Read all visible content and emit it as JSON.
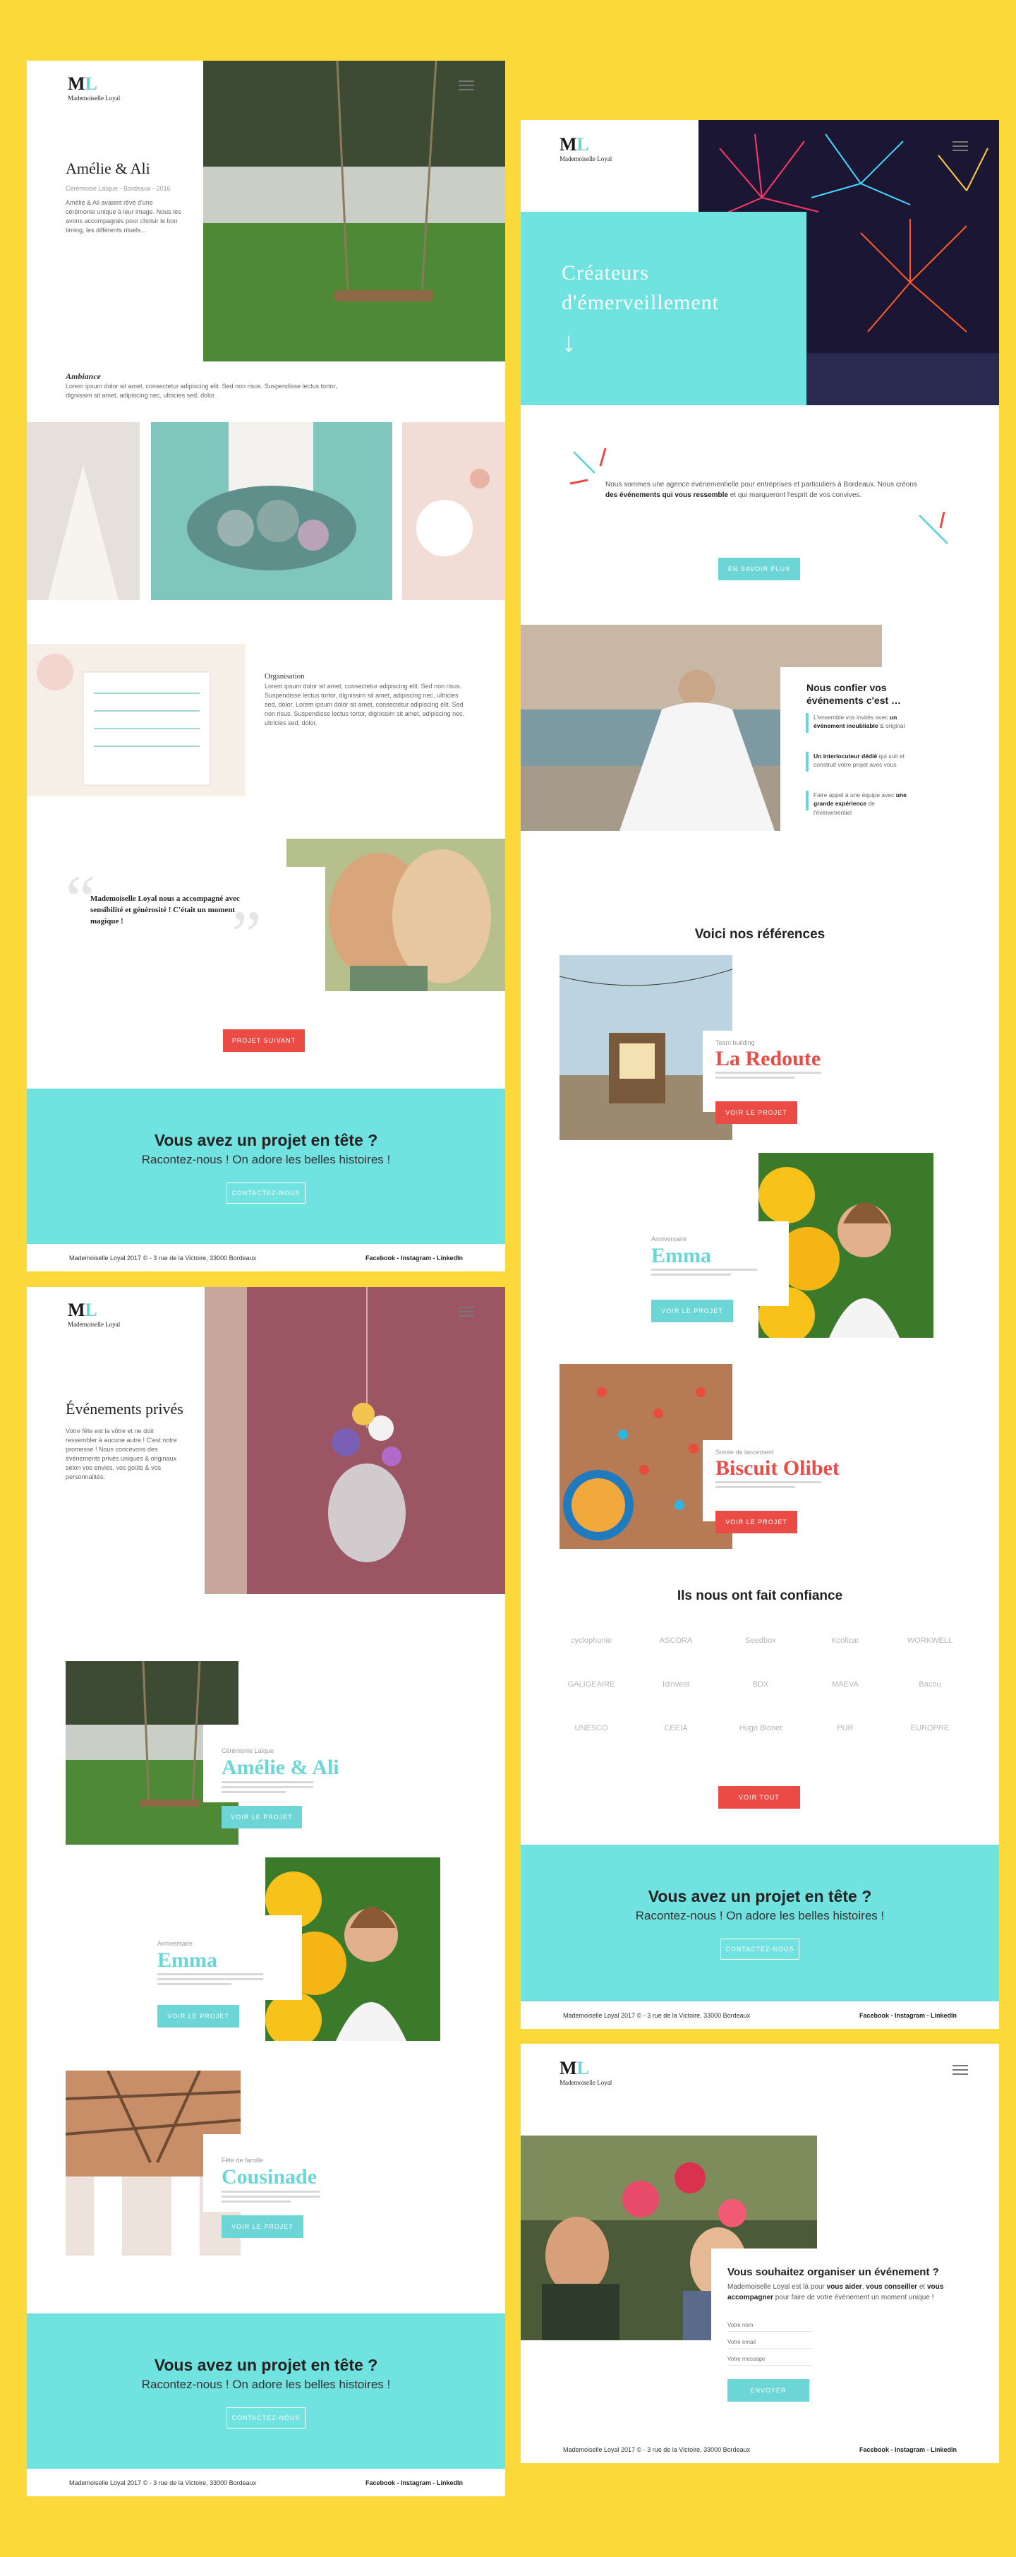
{
  "brand": {
    "mark_a": "M",
    "mark_b": "L",
    "name": "Mademoiselle Loyal"
  },
  "project_page": {
    "title": "Amélie & Ali",
    "meta": "Cérémonie Laïque - Bordeaux - 2016",
    "intro": "Amélie & Ali avaient rêvé d'une cérémonie unique à leur image. Nous les avons accompagnés pour choisir le bon timing, les différents rituels…",
    "ambiance_label": "Ambiance",
    "ambiance_text": "Lorem ipsum dolor sit amet, consectetur adipiscing elit. Sed non risus. Suspendisse lectus tortor, dignissim sit amet, adipiscing nec, ultricies sed, dolor.",
    "organisation_label": "Organisation",
    "organisation_text": "Lorem ipsum dolor sit amet, consectetur adipiscing elit. Sed non risus. Suspendisse lectus tortor, dignissim sit amet, adipiscing nec, ultricies sed, dolor. Lorem ipsum dolor sit amet, consectetur adipiscing elit. Sed non risus. Suspendisse lectus tortor, dignissim sit amet, adipiscing nec, ultricies sed, dolor.",
    "quote": "Mademoiselle Loyal nous a accompagné avec sensibilité et générosité ! C'était un moment magique !",
    "next_button": "PROJET SUIVANT"
  },
  "cta": {
    "title": "Vous avez un projet en tête ?",
    "subtitle": "Racontez-nous ! On adore les belles histoires !",
    "button": "CONTACTEZ-NOUS"
  },
  "footer": {
    "address": "Mademoiselle Loyal 2017 © - 3 rue de la Victoire, 33000 Bordeaux",
    "social": "Facebook - Instagram - LinkedIn"
  },
  "private_page": {
    "title": "Événements privés",
    "intro": "Votre fête est la vôtre et ne doit ressembler à aucune autre ! C'est notre promesse ! Nous concevons des événements privés uniques & originaux selon vos envies, vos goûts & vos personnalités.",
    "items": [
      {
        "kicker": "Cérémonie Laïque",
        "title": "Amélie & Ali",
        "button": "VOIR LE PROJET"
      },
      {
        "kicker": "Anniversaire",
        "title": "Emma",
        "button": "VOIR LE PROJET"
      },
      {
        "kicker": "Fête de famille",
        "title": "Cousinade",
        "button": "VOIR LE PROJET"
      }
    ]
  },
  "home_page": {
    "hero_title_1": "Créateurs",
    "hero_title_2": "d'émerveillement",
    "hero_arrow": "↓",
    "intro_1": "Nous sommes une agence événementielle pour entreprises et particuliers à Bordeaux. Nous créons ",
    "intro_bold": "des événements qui vous ressemble",
    "intro_2": " et qui marqueront l'esprit de vos convives.",
    "more_button": "EN SAVOIR PLUS",
    "trust_title": "Nous confier vos événements c'est …",
    "trust_items": [
      {
        "a": "L'ensemble vos invités avec ",
        "b": "un événement inoubliable",
        "c": " & original"
      },
      {
        "a": "",
        "b": "Un interlocuteur dédié",
        "c": " qui suit et construit votre projet avec vous"
      },
      {
        "a": "Faire appel à une équipe avec ",
        "b": "une grande expérience",
        "c": " de l'événementiel"
      }
    ],
    "references_title": "Voici nos références",
    "references": [
      {
        "kicker": "Team building",
        "title": "La Redoute",
        "button": "VOIR LE PROJET"
      },
      {
        "kicker": "Anniversaire",
        "title": "Emma",
        "button": "VOIR LE PROJET"
      },
      {
        "kicker": "Soirée de lancement",
        "title": "Biscuit Olibet",
        "button": "VOIR LE PROJET"
      }
    ],
    "partners_title": "Ils nous ont fait confiance",
    "partners": [
      "cyclophonie",
      "ASCORA",
      "Seedbox",
      "Kcolicar",
      "WORKWELL",
      "GALIGEAIRE",
      "Idinvest",
      "BDX",
      "MAEVA",
      "Bacou",
      "UNESCO",
      "CEEIA",
      "Hugo Blonet",
      "PUR",
      "EUROPRE"
    ],
    "all_button": "VOIR TOUT"
  },
  "contact_page": {
    "title": "Vous souhaitez organiser un événement ?",
    "text_1": "Mademoiselle Loyal est là pour ",
    "text_b1": "vous aider",
    "text_2": ", ",
    "text_b2": "vous conseiller",
    "text_3": " et ",
    "text_b3": "vous accompagner",
    "text_4": " pour faire de votre événement un moment unique !",
    "field_name": "Votre nom",
    "field_email": "Votre email",
    "field_message": "Votre message",
    "send_button": "ENVOYER"
  }
}
